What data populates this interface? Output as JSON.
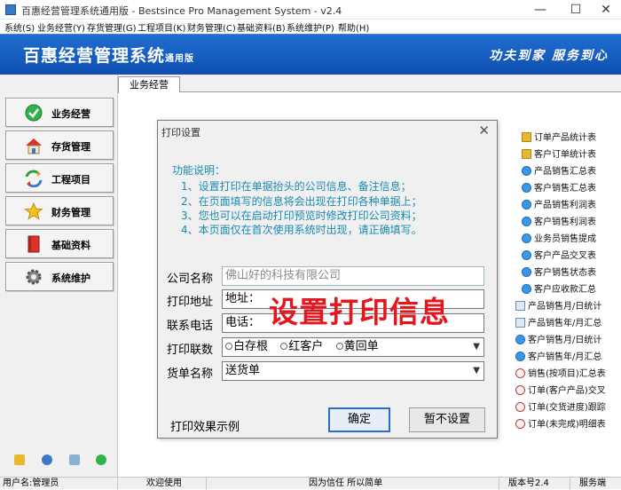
{
  "window": {
    "title": "百惠经营管理系统通用版 - Bestsince Pro Management System - v2.4",
    "minimize": "—",
    "maximize": "☐",
    "close": "✕"
  },
  "menu": [
    "系统(S)",
    "业务经营(Y)",
    "存货管理(G)",
    "工程项目(K)",
    "财务管理(C)",
    "基础资料(B)",
    "系统维护(P)",
    "帮助(H)"
  ],
  "banner": {
    "brand": "百惠经营管理系统",
    "edition": "通用版",
    "slogan": "功夫到家  服务到心"
  },
  "nav": [
    {
      "label": "业务经营",
      "icon": "check-icon"
    },
    {
      "label": "存货管理",
      "icon": "house-icon"
    },
    {
      "label": "工程项目",
      "icon": "recycle-icon"
    },
    {
      "label": "财务管理",
      "icon": "star-icon"
    },
    {
      "label": "基础资料",
      "icon": "book-icon"
    },
    {
      "label": "系统维护",
      "icon": "gear-icon"
    }
  ],
  "tabs": [
    "业务经营"
  ],
  "right_links": [
    "订单产品统计表",
    "客户订单统计表",
    "产品销售汇总表",
    "客户销售汇总表",
    "产品销售利润表",
    "客户销售利润表",
    "业务员销售提成",
    "客户产品交叉表",
    "客户销售状态表",
    "客户应收款汇总",
    "产品销售月/日统计",
    "产品销售年/月汇总",
    "客户销售月/日统计",
    "客户销售年/月汇总",
    "销售(按项目)汇总表",
    "订单(客户产品)交叉",
    "订单(交货进度)跟踪",
    "订单(未完成)明细表"
  ],
  "dialog": {
    "title": "打印设置",
    "close": "✕",
    "desc": [
      "功能说明：",
      "1、设置打印在单据抬头的公司信息、备注信息；",
      "2、在页面填写的信息将会出现在打印各种单据上；",
      "3、您也可以在启动打印预览时修改打印公司资料；",
      "4、本页面仅在首次使用系统时出现，请正确填写。"
    ],
    "fields": {
      "company_label": "公司名称",
      "company_placeholder": "佛山好的科技有限公司",
      "address_label": "打印地址",
      "address_value": "地址：",
      "phone_label": "联系电话",
      "phone_value": "电话：",
      "copies_label": "打印联数",
      "copies_options": [
        "白存根",
        "红客户",
        "黄回单"
      ],
      "slip_label": "货单名称",
      "slip_value": "送货单"
    },
    "overlay": "设置打印信息",
    "preview_link": "打印效果示例",
    "ok": "确定",
    "skip": "暂不设置"
  },
  "status": {
    "user": "用户名:管理员",
    "welcome": "欢迎使用",
    "motto": "因为信任 所以简单",
    "version": "版本号2.4",
    "service": "服务端"
  }
}
